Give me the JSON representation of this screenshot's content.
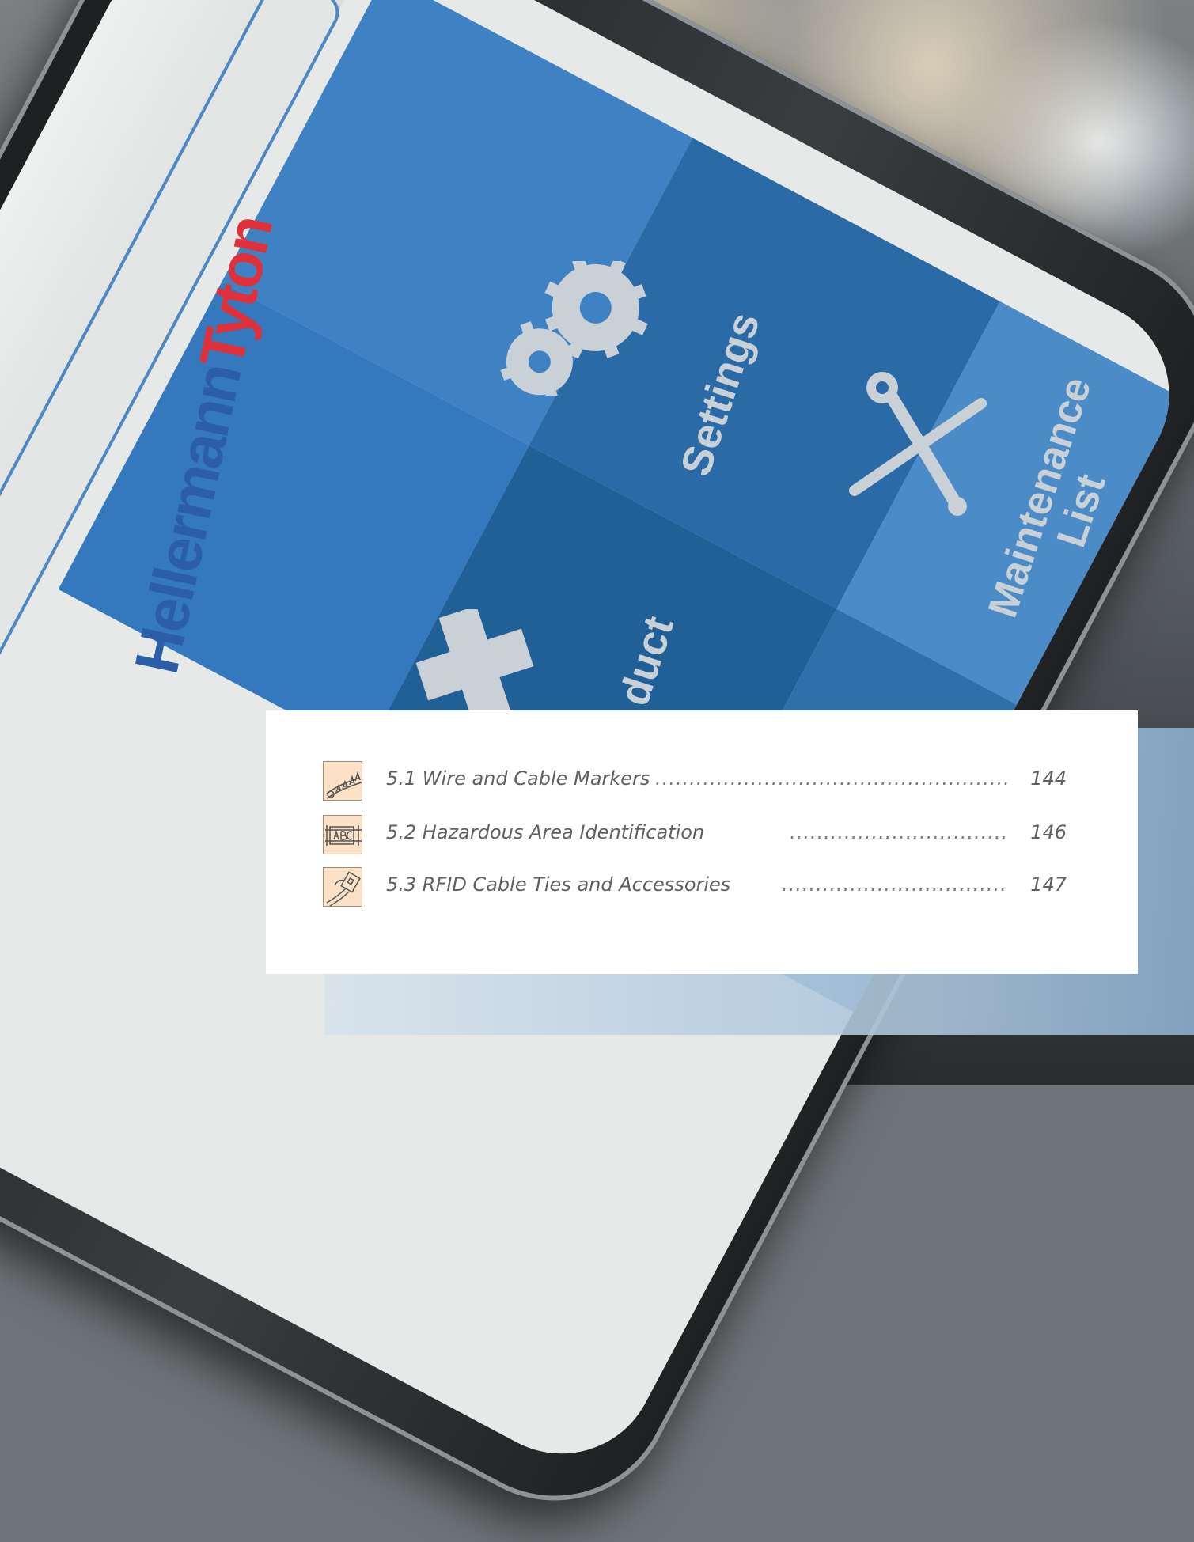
{
  "brand": {
    "part1": "Hellermann",
    "part2": "Tyton",
    "color1": "#2c5ea7",
    "color2": "#e0313a"
  },
  "phone_app": {
    "tiles": [
      "Settings",
      "Maintenance",
      "List",
      "duct"
    ],
    "icons": [
      "gears-icon",
      "wrench-screwdriver-icon",
      "plus-icon"
    ]
  },
  "toc": {
    "items": [
      {
        "title": "5.1 Wire and Cable Markers",
        "page": "144",
        "icon": "wire-marker-icon"
      },
      {
        "title": "5.2 Hazardous Area Identification",
        "page": "146",
        "icon": "hazardous-marker-icon"
      },
      {
        "title": "5.3 RFID Cable Ties and Accessories",
        "page": "147",
        "icon": "rfid-tie-icon"
      }
    ]
  }
}
